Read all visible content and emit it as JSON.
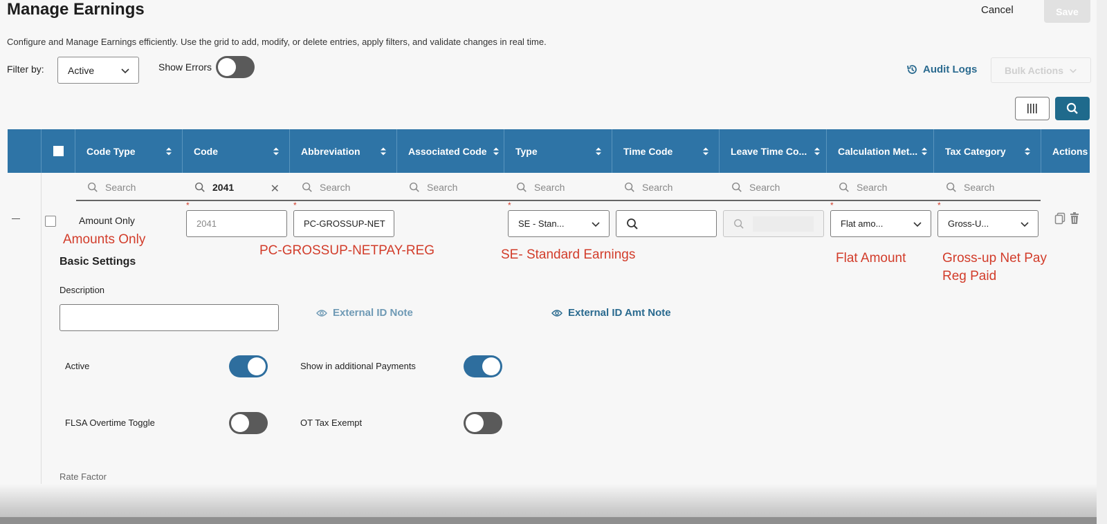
{
  "page": {
    "title": "Manage Earnings",
    "description": "Configure and Manage Earnings efficiently. Use the grid to add, modify, or delete entries, apply filters, and validate changes in real time.",
    "cancel_label": "Cancel",
    "save_label": "Save"
  },
  "toolbar": {
    "filter_label": "Filter by:",
    "filter_value": "Active",
    "show_errors_label": "Show Errors",
    "show_errors_on": false,
    "audit_logs_label": "Audit Logs",
    "bulk_actions_label": "Bulk Actions"
  },
  "grid": {
    "columns": [
      "Code Type",
      "Code",
      "Abbreviation",
      "Associated Code",
      "Type",
      "Time Code",
      "Leave Time Co...",
      "Calculation Met...",
      "Tax Category",
      "Actions"
    ],
    "filters": {
      "placeholder": "Search",
      "code_value": "2041"
    },
    "row": {
      "code_type": "Amount Only",
      "code": "2041",
      "abbreviation": "PC-GROSSUP-NET",
      "type": "SE - Stan...",
      "calculation": "Flat amo...",
      "tax_category": "Gross-U..."
    }
  },
  "annotations": {
    "code_type": "Amounts Only",
    "abbreviation": "PC-GROSSUP-NETPAY-REG",
    "type": "SE- Standard Earnings",
    "calculation": "Flat Amount",
    "tax_line1": "Gross-up Net Pay",
    "tax_line2": "Reg Paid"
  },
  "detail": {
    "section_title": "Basic Settings",
    "description_label": "Description",
    "description_value": "",
    "external_id_note": "External ID Note",
    "external_id_amt_note": "External ID Amt Note",
    "active_label": "Active",
    "active_on": true,
    "show_additional_label": "Show in additional Payments",
    "show_additional_on": true,
    "flsa_label": "FLSA Overtime Toggle",
    "flsa_on": false,
    "ot_exempt_label": "OT Tax Exempt",
    "ot_exempt_on": false,
    "rate_factor_label": "Rate Factor"
  },
  "icons": [
    "chevron-down-icon",
    "history-icon",
    "columns-icon",
    "search-icon",
    "sort-icon",
    "close-icon",
    "eye-icon",
    "copy-icon",
    "trash-icon"
  ]
}
